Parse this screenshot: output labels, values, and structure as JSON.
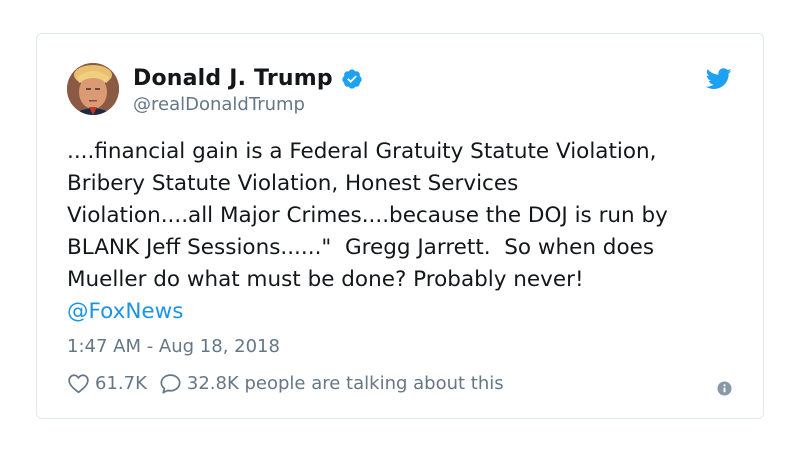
{
  "tweet": {
    "author": {
      "display_name": "Donald J. Trump",
      "handle": "@realDonaldTrump",
      "verified": true
    },
    "text": "....financial gain is a Federal Gratuity Statute Violation,\nBribery Statute Violation, Honest Services\nViolation....all Major Crimes....because the DOJ is run by\nBLANK Jeff Sessions......\"  Gregg Jarrett.  So when does\nMueller do what must be done? Probably never!",
    "mention": "@FoxNews",
    "timestamp": "1:47 AM - Aug 18, 2018",
    "likes": "61.7K",
    "replies": "32.8K people are talking about this"
  },
  "icons": {
    "verified": "verified-badge-icon",
    "brand": "twitter-bird-icon",
    "like": "heart-icon",
    "reply": "speech-bubble-icon",
    "info": "info-icon"
  },
  "colors": {
    "brand_blue": "#1da1f2",
    "link_blue": "#1b95e0",
    "secondary_text": "#657786",
    "border": "#e1e8ed"
  }
}
